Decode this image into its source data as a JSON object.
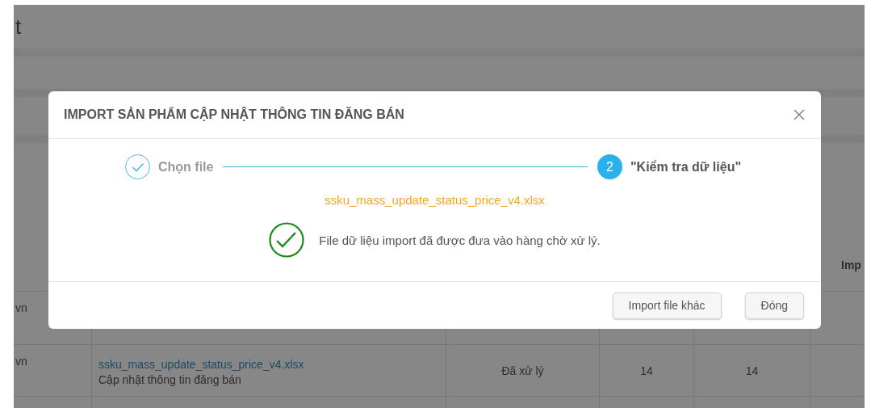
{
  "background_page": {
    "title": "t",
    "table": {
      "column_6_header": "Imp",
      "rows": [
        {
          "column_1": "vn"
        },
        {
          "column_1": "vn",
          "file_name": "ssku_mass_update_status_price_v4.xlsx",
          "action": "Cập nhật thông tin đăng bán",
          "status": "Đã xử lý",
          "column_4": "14",
          "column_5": "14"
        }
      ]
    }
  },
  "modal": {
    "title": "IMPORT SẢN PHẨM CẬP NHẬT THÔNG TIN ĐĂNG BÁN",
    "steps": [
      {
        "label": "Chọn file",
        "done": true,
        "selected": false
      },
      {
        "number": "2",
        "label": "\"Kiểm tra dữ liệu\"",
        "done": false,
        "selected": true
      }
    ],
    "file_name": "ssku_mass_update_status_price_v4.xlsx",
    "message": "File dữ liệu import đã được đưa vào hàng chờ xử lý.",
    "buttons": [
      "Import file khác",
      "Đóng"
    ]
  }
}
